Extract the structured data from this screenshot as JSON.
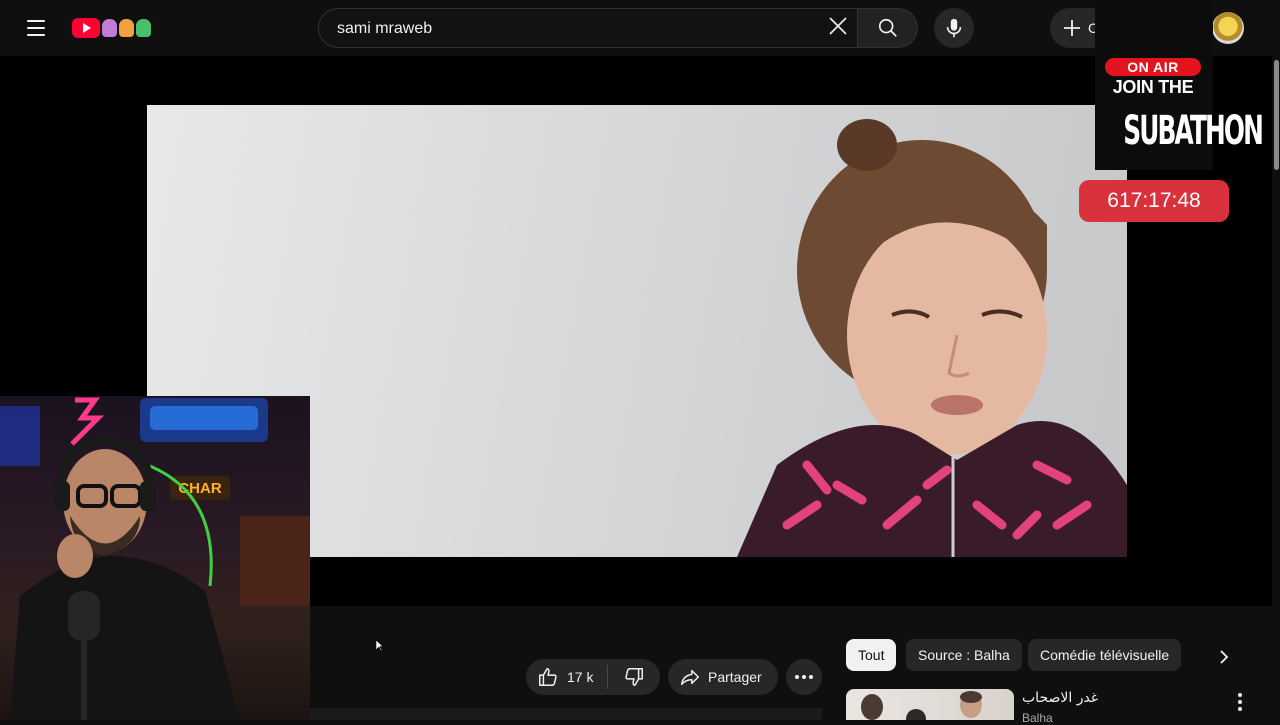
{
  "search": {
    "query": "sami mraweb"
  },
  "header": {
    "create_label": "C"
  },
  "overlay": {
    "on_air": "ON AIR",
    "join_line": "JOIN THE",
    "event_line": "SUBATHON",
    "timer": "617:17:48"
  },
  "actions": {
    "likes": "17 k",
    "share_label": "Partager"
  },
  "chips": [
    {
      "label": "Tout",
      "active": true
    },
    {
      "label": "Source : Balha",
      "active": false
    },
    {
      "label": "Comédie télévisuelle",
      "active": false
    }
  ],
  "recommended": [
    {
      "title": "غدر الاصحاب",
      "channel": "Balha"
    }
  ],
  "colors": {
    "background": "#0f0f0f",
    "brand_red": "#ff0033",
    "timer_red": "#d9323c",
    "chip_bg": "#272727",
    "chip_active_bg": "#f1f1f1"
  }
}
